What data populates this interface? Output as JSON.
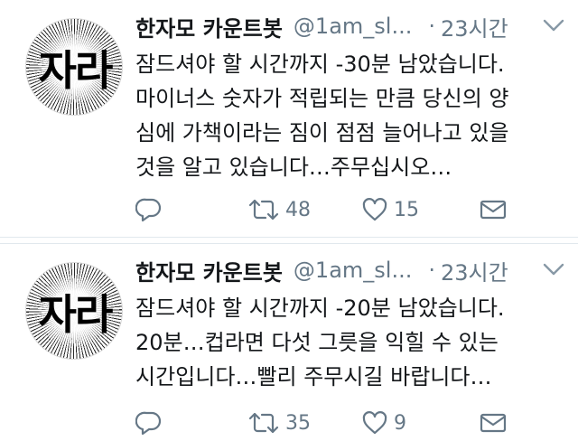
{
  "account": {
    "display_name": "한자모 카운트봇",
    "handle": "@1am_sl...",
    "avatar_text": "자라"
  },
  "tweets": [
    {
      "time": "23시간",
      "lines": [
        "잠드셔야 할 시간까지 -30분 남았습니다.",
        "마이너스 숫자가 적립되는 만큼 당신의 양",
        "심에 가책이라는 짐이 점점 늘어나고 있을",
        "것을 알고 있습니다…주무십시오…"
      ],
      "retweets": "48",
      "likes": "15"
    },
    {
      "time": "23시간",
      "lines": [
        "잠드셔야 할 시간까지 -20분 남았습니다.",
        "20분…컵라면 다섯 그릇을 익힐 수 있는",
        "시간입니다…빨리 주무시길 바랍니다…"
      ],
      "retweets": "35",
      "likes": "9"
    }
  ],
  "separator": "·",
  "colors": {
    "text": "#14171a",
    "secondary": "#657786",
    "divider": "#e1e8ed"
  },
  "icons": [
    "reply-icon",
    "retweet-icon",
    "like-icon",
    "direct-message-icon",
    "chevron-down-icon"
  ]
}
